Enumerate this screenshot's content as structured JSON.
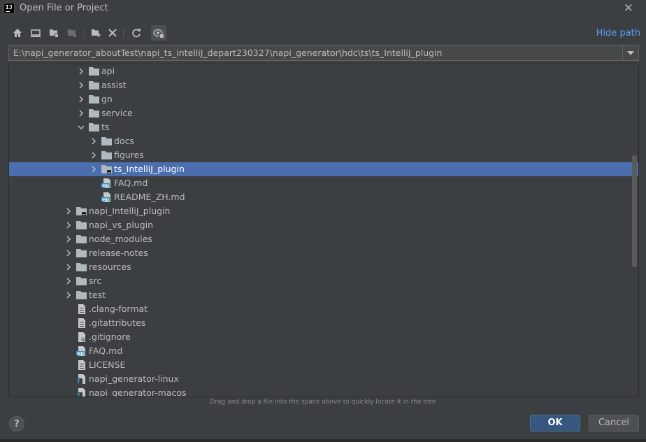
{
  "window": {
    "title": "Open File or Project",
    "logo_text": "IJ"
  },
  "toolbar": {
    "buttons": [
      {
        "icon": "home-icon"
      },
      {
        "icon": "desktop-icon"
      },
      {
        "icon": "project-folder-icon"
      },
      {
        "icon": "module-folder-icon"
      },
      {
        "icon": "new-folder-icon"
      },
      {
        "icon": "delete-icon"
      },
      {
        "icon": "refresh-icon"
      },
      {
        "icon": "show-hidden-icon"
      }
    ],
    "hide_path_label": "Hide path"
  },
  "path": {
    "value": "E:\\napi_generator_aboutTest\\napi_ts_intelliJ_depart230327\\napi_generator\\hdc\\ts\\ts_IntelliJ_plugin"
  },
  "tree": {
    "selected_label": "ts_IntelliJ_plugin",
    "rows": [
      {
        "label": "api",
        "type": "folder",
        "depth": 3,
        "expand": "collapsed"
      },
      {
        "label": "assist",
        "type": "folder",
        "depth": 3,
        "expand": "collapsed"
      },
      {
        "label": "gn",
        "type": "folder",
        "depth": 3,
        "expand": "collapsed"
      },
      {
        "label": "service",
        "type": "folder",
        "depth": 3,
        "expand": "collapsed"
      },
      {
        "label": "ts",
        "type": "folder",
        "depth": 3,
        "expand": "expanded"
      },
      {
        "label": "docs",
        "type": "folder",
        "depth": 4,
        "expand": "collapsed"
      },
      {
        "label": "figures",
        "type": "folder",
        "depth": 4,
        "expand": "collapsed"
      },
      {
        "label": "ts_IntelliJ_plugin",
        "type": "module-folder",
        "depth": 4,
        "expand": "collapsed"
      },
      {
        "label": "FAQ.md",
        "type": "md",
        "depth": 4,
        "expand": "none"
      },
      {
        "label": "README_ZH.md",
        "type": "md",
        "depth": 4,
        "expand": "none"
      },
      {
        "label": "napi_IntelliJ_plugin",
        "type": "module-folder",
        "depth": 2,
        "expand": "collapsed"
      },
      {
        "label": "napi_vs_plugin",
        "type": "folder",
        "depth": 2,
        "expand": "collapsed"
      },
      {
        "label": "node_modules",
        "type": "folder",
        "depth": 2,
        "expand": "collapsed"
      },
      {
        "label": "release-notes",
        "type": "folder",
        "depth": 2,
        "expand": "collapsed"
      },
      {
        "label": "resources",
        "type": "folder",
        "depth": 2,
        "expand": "collapsed"
      },
      {
        "label": "src",
        "type": "folder",
        "depth": 2,
        "expand": "collapsed"
      },
      {
        "label": "test",
        "type": "folder",
        "depth": 2,
        "expand": "collapsed"
      },
      {
        "label": ".clang-format",
        "type": "text",
        "depth": 2,
        "expand": "none"
      },
      {
        "label": ".gitattributes",
        "type": "text",
        "depth": 2,
        "expand": "none"
      },
      {
        "label": ".gitignore",
        "type": "ignore",
        "depth": 2,
        "expand": "none"
      },
      {
        "label": "FAQ.md",
        "type": "md",
        "depth": 2,
        "expand": "none"
      },
      {
        "label": "LICENSE",
        "type": "text",
        "depth": 2,
        "expand": "none"
      },
      {
        "label": "napi_generator-linux",
        "type": "unknown",
        "depth": 2,
        "expand": "none"
      },
      {
        "label": "napi_generator-macos",
        "type": "unknown",
        "depth": 2,
        "expand": "none"
      }
    ]
  },
  "hint": "Drag and drop a file into the space above to quickly locate it in the tree",
  "footer": {
    "help_label": "?",
    "ok_label": "OK",
    "cancel_label": "Cancel"
  },
  "colors": {
    "background": "#3c3f41",
    "selection": "#4b6eaf",
    "link": "#589df6",
    "folder": "#aeb9c0",
    "md_badge": "#3592c4"
  }
}
